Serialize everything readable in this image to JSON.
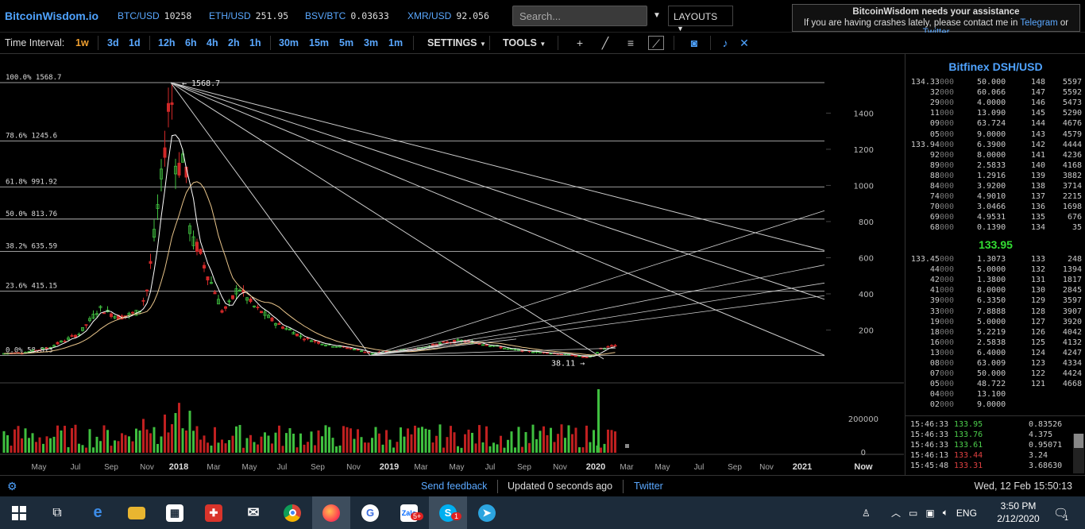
{
  "app": {
    "logo": "BitcoinWisdom.io"
  },
  "tickers": [
    {
      "symbol": "BTC/USD",
      "value": "10258"
    },
    {
      "symbol": "ETH/USD",
      "value": "251.95"
    },
    {
      "symbol": "BSV/BTC",
      "value": "0.03633"
    },
    {
      "symbol": "XMR/USD",
      "value": "92.056"
    }
  ],
  "search": {
    "placeholder": "Search..."
  },
  "layouts_label": "LAYOUTS",
  "assist": {
    "title": "BitcoinWisdom needs your assistance",
    "text": "If you are having crashes lately, please contact me in",
    "link1": "Telegram",
    "or": "or",
    "link2": "Twitter"
  },
  "toolbar": {
    "time_interval_label": "Time Interval:",
    "intervals": [
      "1w",
      "3d",
      "1d",
      "12h",
      "6h",
      "4h",
      "2h",
      "1h",
      "30m",
      "15m",
      "5m",
      "3m",
      "1m"
    ],
    "active_interval": "1w",
    "settings_label": "SETTINGS",
    "tools_label": "TOOLS",
    "tool_icons": [
      "crosshair-icon",
      "trendline-icon",
      "horizontal-lines-icon",
      "fan-tool-icon",
      "camera-icon",
      "bell-icon",
      "fullscreen-icon"
    ]
  },
  "chart_data": {
    "type": "candlestick",
    "market": "Bitfinex DSH/USD",
    "y_axis_ticks": [
      "1400",
      "1200",
      "1000",
      "800",
      "600",
      "400",
      "200"
    ],
    "volume_axis_ticks": [
      "200000",
      "0"
    ],
    "x_axis_labels": [
      "May",
      "Jul",
      "Sep",
      "Nov",
      "2018",
      "Mar",
      "May",
      "Jul",
      "Sep",
      "Nov",
      "2019",
      "Mar",
      "May",
      "Jul",
      "Sep",
      "Nov",
      "2020",
      "Mar",
      "May",
      "Jul",
      "Sep",
      "Nov",
      "2021",
      "Now"
    ],
    "fib_levels": [
      {
        "label": "100.0% 1568.7",
        "value": 1568.7
      },
      {
        "label": "78.6% 1245.6",
        "value": 1245.6
      },
      {
        "label": "61.8% 991.92",
        "value": 991.92
      },
      {
        "label": "50.0% 813.76",
        "value": 813.76
      },
      {
        "label": "38.2% 635.59",
        "value": 635.59
      },
      {
        "label": "23.6% 415.15",
        "value": 415.15
      },
      {
        "label": "0.0% 58.813",
        "value": 58.813
      }
    ],
    "annotations": {
      "high_label": "1568.7",
      "low_label": "38.11"
    }
  },
  "orderbook": {
    "title": "Bitfinex DSH/USD",
    "asks": [
      {
        "p1": "134.33",
        "p2": "000",
        "amt": "50.000",
        "cnt": "148",
        "tot": "5597"
      },
      {
        "p1": "32",
        "p2": "000",
        "amt": "60.066",
        "cnt": "147",
        "tot": "5592"
      },
      {
        "p1": "29",
        "p2": "000",
        "amt": "4.0000",
        "cnt": "146",
        "tot": "5473"
      },
      {
        "p1": "11",
        "p2": "000",
        "amt": "13.090",
        "cnt": "145",
        "tot": "5290"
      },
      {
        "p1": "09",
        "p2": "000",
        "amt": "63.724",
        "cnt": "144",
        "tot": "4676"
      },
      {
        "p1": "05",
        "p2": "000",
        "amt": "9.0000",
        "cnt": "143",
        "tot": "4579"
      },
      {
        "p1": "133.94",
        "p2": "000",
        "amt": "6.3900",
        "cnt": "142",
        "tot": "4444"
      },
      {
        "p1": "92",
        "p2": "000",
        "amt": "8.0000",
        "cnt": "141",
        "tot": "4236"
      },
      {
        "p1": "89",
        "p2": "000",
        "amt": "2.5833",
        "cnt": "140",
        "tot": "4168"
      },
      {
        "p1": "88",
        "p2": "000",
        "amt": "1.2916",
        "cnt": "139",
        "tot": "3882"
      },
      {
        "p1": "84",
        "p2": "000",
        "amt": "3.9200",
        "cnt": "138",
        "tot": "3714"
      },
      {
        "p1": "74",
        "p2": "000",
        "amt": "4.9010",
        "cnt": "137",
        "tot": "2215"
      },
      {
        "p1": "70",
        "p2": "000",
        "amt": "3.0466",
        "cnt": "136",
        "tot": "1698"
      },
      {
        "p1": "69",
        "p2": "000",
        "amt": "4.9531",
        "cnt": "135",
        "tot": "676"
      },
      {
        "p1": "68",
        "p2": "000",
        "amt": "0.1390",
        "cnt": "134",
        "tot": "35"
      }
    ],
    "mid_price": "133.95",
    "bids": [
      {
        "p1": "133.45",
        "p2": "000",
        "amt": "1.3073",
        "cnt": "133",
        "tot": "248"
      },
      {
        "p1": "44",
        "p2": "000",
        "amt": "5.0000",
        "cnt": "132",
        "tot": "1394"
      },
      {
        "p1": "42",
        "p2": "000",
        "amt": "1.3800",
        "cnt": "131",
        "tot": "1817"
      },
      {
        "p1": "41",
        "p2": "000",
        "amt": "8.0000",
        "cnt": "130",
        "tot": "2845"
      },
      {
        "p1": "39",
        "p2": "000",
        "amt": "6.3350",
        "cnt": "129",
        "tot": "3597"
      },
      {
        "p1": "33",
        "p2": "000",
        "amt": "7.8888",
        "cnt": "128",
        "tot": "3907"
      },
      {
        "p1": "19",
        "p2": "000",
        "amt": "5.0000",
        "cnt": "127",
        "tot": "3920"
      },
      {
        "p1": "18",
        "p2": "000",
        "amt": "5.2219",
        "cnt": "126",
        "tot": "4042"
      },
      {
        "p1": "16",
        "p2": "000",
        "amt": "2.5838",
        "cnt": "125",
        "tot": "4132"
      },
      {
        "p1": "13",
        "p2": "000",
        "amt": "6.4000",
        "cnt": "124",
        "tot": "4247"
      },
      {
        "p1": "08",
        "p2": "000",
        "amt": "63.009",
        "cnt": "123",
        "tot": "4334"
      },
      {
        "p1": "07",
        "p2": "000",
        "amt": "50.000",
        "cnt": "122",
        "tot": "4424"
      },
      {
        "p1": "05",
        "p2": "000",
        "amt": "48.722",
        "cnt": "121",
        "tot": "4668"
      },
      {
        "p1": "04",
        "p2": "000",
        "amt": "13.100",
        "cnt": "",
        "tot": ""
      },
      {
        "p1": "02",
        "p2": "000",
        "amt": "9.0000",
        "cnt": "",
        "tot": ""
      }
    ],
    "trades": [
      {
        "time": "15:46:33",
        "price": "133.95",
        "dir": "up",
        "size": "0.83526"
      },
      {
        "time": "15:46:33",
        "price": "133.76",
        "dir": "up",
        "size": "4.375"
      },
      {
        "time": "15:46:33",
        "price": "133.61",
        "dir": "up",
        "size": "0.95071"
      },
      {
        "time": "15:46:13",
        "price": "133.44",
        "dir": "dn",
        "size": "3.24"
      },
      {
        "time": "15:45:48",
        "price": "133.31",
        "dir": "dn",
        "size": "3.68630"
      }
    ]
  },
  "statusbar": {
    "feedback": "Send feedback",
    "updated": "Updated 0 seconds ago",
    "twitter": "Twitter",
    "datetime": "Wed, 12 Feb 15:50:13"
  },
  "taskbar": {
    "apps": [
      "windows-start-icon",
      "task-view-icon",
      "edge-icon",
      "file-explorer-icon",
      "store-icon",
      "gift-app-icon",
      "mail-icon",
      "chrome-icon",
      "firefox-icon",
      "g-app-icon",
      "zalo-icon",
      "skype-icon",
      "telegram-icon"
    ],
    "zalo_badge": "5+",
    "skype_badge": "1",
    "language": "ENG",
    "time": "3:50 PM",
    "date": "2/12/2020",
    "notification_count": "1"
  }
}
